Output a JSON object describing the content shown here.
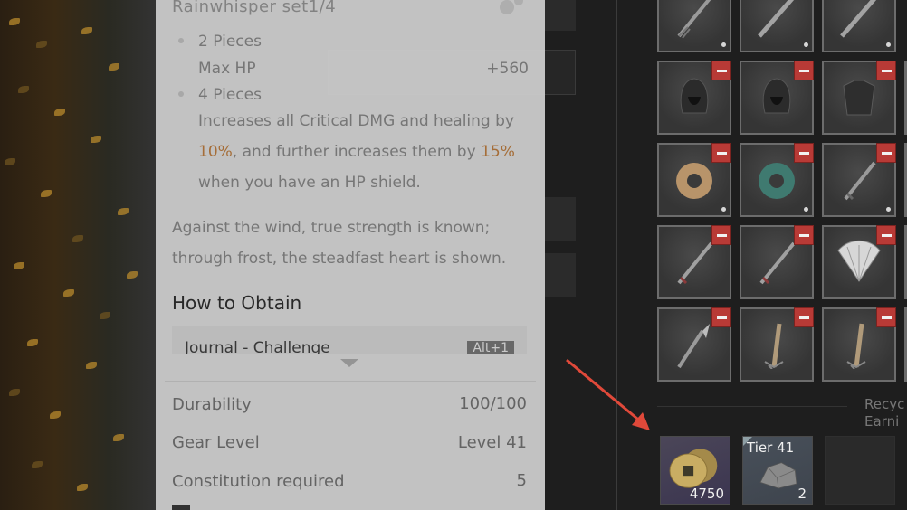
{
  "tooltip": {
    "set_name": "Rainwhisper set1/4",
    "tier2": {
      "label": "2 Pieces",
      "stat_name": "Max HP",
      "stat_value": "+560"
    },
    "tier4": {
      "label": "4 Pieces",
      "desc_line1": "Increases all Critical DMG and healing by",
      "desc_pct1": "10%",
      "desc_mid": ", and further increases them by",
      "desc_pct2": "15%",
      "desc_line3": "when you have an HP shield."
    },
    "lore_line1": "Against the wind, true strength is known;",
    "lore_line2": "through frost, the steadfast heart is shown.",
    "how_to_obtain_title": "How to Obtain",
    "source": {
      "label": "Journal - Challenge",
      "hotkey": "Alt+1"
    },
    "stats": [
      {
        "label": "Durability",
        "value": "100/100"
      },
      {
        "label": "Gear Level",
        "value": "Level 41"
      },
      {
        "label": "Constitution required",
        "value": "5"
      }
    ]
  },
  "inventory": {
    "recycle_label": "Recyc\nEarni",
    "resources": [
      {
        "type": "coins",
        "count": "4750"
      },
      {
        "type": "ore",
        "tier": "Tier 41",
        "count": "2"
      }
    ]
  },
  "colors": {
    "accent": "#b0743a",
    "remove_badge": "#b83a36",
    "arrow": "#e0493a"
  }
}
